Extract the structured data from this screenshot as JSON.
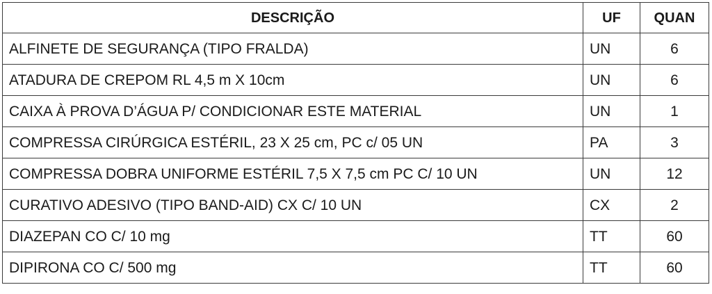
{
  "table": {
    "headers": {
      "description": "DESCRIÇÃO",
      "unit": "UF",
      "quantity": "QUAN"
    },
    "rows": [
      {
        "description": "ALFINETE DE SEGURANÇA (TIPO FRALDA)",
        "unit": "UN",
        "quantity": "6"
      },
      {
        "description": "ATADURA DE CREPOM RL 4,5 m X 10cm",
        "unit": "UN",
        "quantity": "6"
      },
      {
        "description": "CAIXA À PROVA D’ÁGUA P/ CONDICIONAR ESTE MATERIAL",
        "unit": "UN",
        "quantity": "1"
      },
      {
        "description": "COMPRESSA CIRÚRGICA ESTÉRIL, 23 X 25 cm, PC c/ 05 UN",
        "unit": "PA",
        "quantity": "3"
      },
      {
        "description": "COMPRESSA DOBRA UNIFORME ESTÉRIL 7,5 X 7,5 cm PC C/ 10 UN",
        "unit": "UN",
        "quantity": "12"
      },
      {
        "description": "CURATIVO ADESIVO (TIPO BAND-AID) CX C/ 10 UN",
        "unit": "CX",
        "quantity": "2"
      },
      {
        "description": "DIAZEPAN CO C/ 10 mg",
        "unit": "TT",
        "quantity": "60"
      },
      {
        "description": "DIPIRONA CO C/ 500 mg",
        "unit": "TT",
        "quantity": "60"
      }
    ]
  }
}
